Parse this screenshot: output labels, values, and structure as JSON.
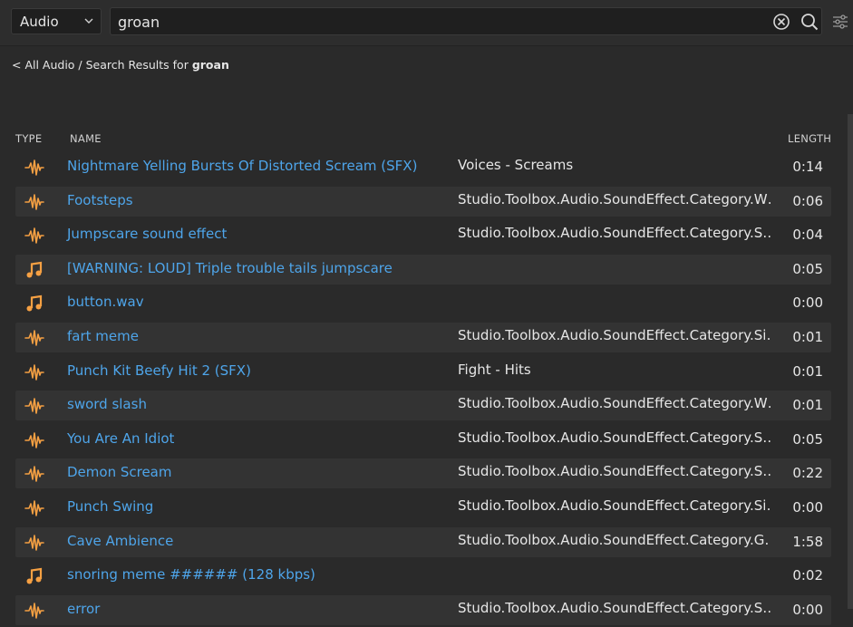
{
  "search": {
    "category": "Audio",
    "query": "groan"
  },
  "breadcrumb": {
    "back_label": "< All Audio",
    "separator": " / ",
    "prefix": "Search Results for ",
    "query": "groan"
  },
  "columns": {
    "type": "TYPE",
    "name": "NAME",
    "length": "LENGTH"
  },
  "colors": {
    "accent_link": "#4ea5ea",
    "icon_orange": "#f5a043",
    "background": "#2a2a2a",
    "row_alt": "#333333"
  },
  "rows": [
    {
      "type": "sound-wave",
      "name": "Nightmare Yelling Bursts Of Distorted Scream (SFX)",
      "category": "Voices - Screams",
      "length": "0:14"
    },
    {
      "type": "sound-wave",
      "name": "Footsteps",
      "category": "Studio.Toolbox.Audio.SoundEffect.Category.W…",
      "length": "0:06"
    },
    {
      "type": "sound-wave",
      "name": "Jumpscare sound effect",
      "category": "Studio.Toolbox.Audio.SoundEffect.Category.S…",
      "length": "0:04"
    },
    {
      "type": "music-note",
      "name": "[WARNING: LOUD] Triple trouble tails jumpscare",
      "category": "",
      "length": "0:05"
    },
    {
      "type": "music-note",
      "name": "button.wav",
      "category": "",
      "length": "0:00"
    },
    {
      "type": "sound-wave",
      "name": "fart meme",
      "category": "Studio.Toolbox.Audio.SoundEffect.Category.Si…",
      "length": "0:01"
    },
    {
      "type": "sound-wave",
      "name": "Punch Kit Beefy Hit 2 (SFX)",
      "category": "Fight - Hits",
      "length": "0:01"
    },
    {
      "type": "sound-wave",
      "name": "sword slash",
      "category": "Studio.Toolbox.Audio.SoundEffect.Category.W…",
      "length": "0:01"
    },
    {
      "type": "sound-wave",
      "name": "You Are An Idiot",
      "category": "Studio.Toolbox.Audio.SoundEffect.Category.S…",
      "length": "0:05"
    },
    {
      "type": "sound-wave",
      "name": "Demon Scream",
      "category": "Studio.Toolbox.Audio.SoundEffect.Category.S…",
      "length": "0:22"
    },
    {
      "type": "sound-wave",
      "name": "Punch Swing",
      "category": "Studio.Toolbox.Audio.SoundEffect.Category.Si…",
      "length": "0:00"
    },
    {
      "type": "sound-wave",
      "name": "Cave Ambience",
      "category": "Studio.Toolbox.Audio.SoundEffect.Category.G…",
      "length": "1:58"
    },
    {
      "type": "music-note",
      "name": "snoring meme ###### (128 kbps)",
      "category": "",
      "length": "0:02"
    },
    {
      "type": "sound-wave",
      "name": "error",
      "category": "Studio.Toolbox.Audio.SoundEffect.Category.S…",
      "length": "0:00"
    }
  ]
}
